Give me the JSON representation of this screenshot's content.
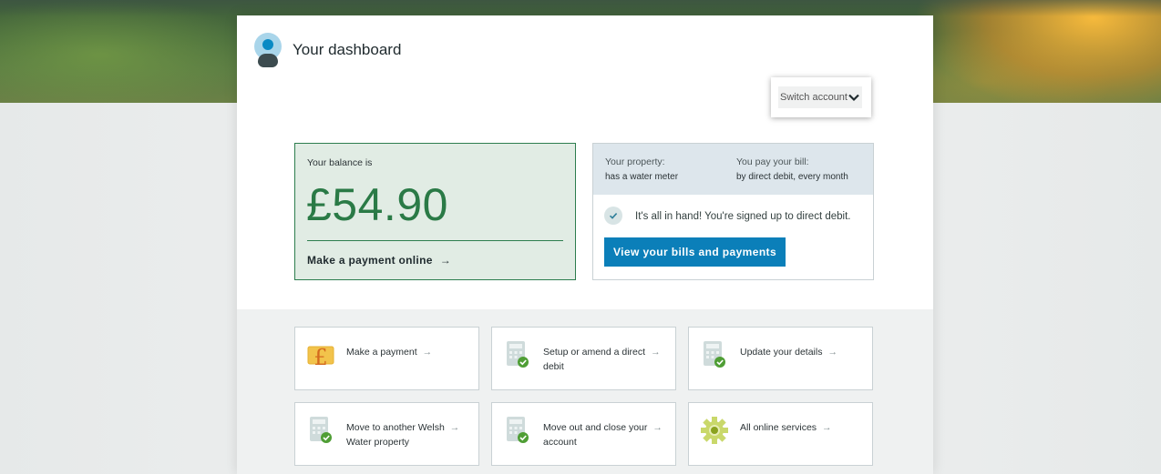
{
  "header": {
    "title": "Your dashboard"
  },
  "switch_account": {
    "label": "Switch account"
  },
  "balance": {
    "label": "Your balance is",
    "amount": "£54.90",
    "payment_link": "Make a payment online",
    "arrow": "→"
  },
  "property": {
    "property_label": "Your property:",
    "property_value": "has a water meter",
    "bill_label": "You pay your bill:",
    "bill_value": "by direct debit, every month",
    "status_message": "It's all in hand! You're signed up to direct debit.",
    "view_button": "View your bills and payments"
  },
  "tiles": [
    {
      "line1": "Make a payment",
      "line2": "",
      "arrow": "→",
      "icon": "pound-icon"
    },
    {
      "line1": "Setup or amend a direct",
      "line2": "debit",
      "arrow": "→",
      "icon": "calculator-check-icon"
    },
    {
      "line1": "Update your details",
      "line2": "",
      "arrow": "→",
      "icon": "calculator-check-icon"
    },
    {
      "line1": "Move to another Welsh",
      "line2": "Water property",
      "arrow": "→",
      "icon": "calculator-check-icon"
    },
    {
      "line1": "Move out and close your",
      "line2": "account",
      "arrow": "→",
      "icon": "calculator-check-icon"
    },
    {
      "line1": "All online services",
      "line2": "",
      "arrow": "→",
      "icon": "gear-icon"
    }
  ],
  "colors": {
    "brand_blue": "#0b7fb9",
    "balance_green": "#2a7a46",
    "check_green": "#4f9e35",
    "pound_orange": "#d46a1f"
  }
}
